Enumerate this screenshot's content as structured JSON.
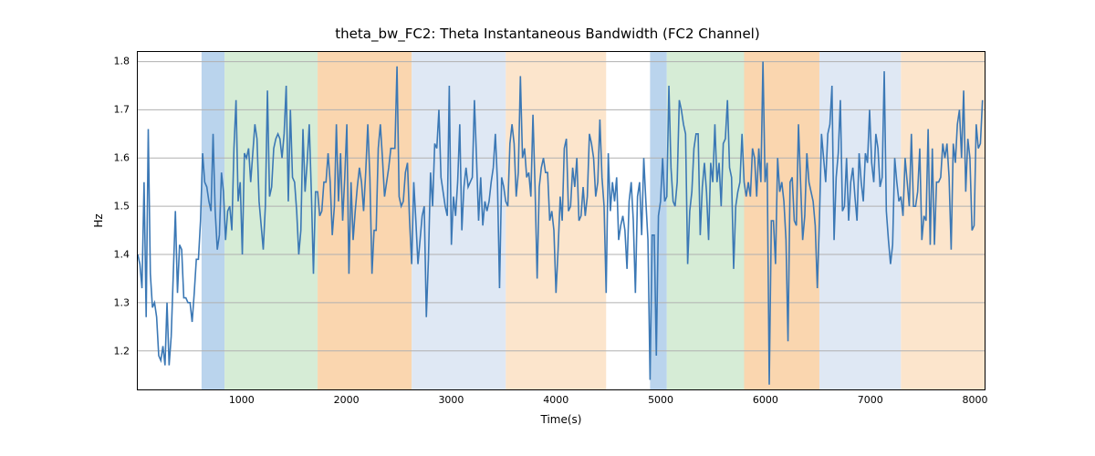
{
  "chart_data": {
    "type": "line",
    "title": "theta_bw_FC2: Theta Instantaneous Bandwidth (FC2 Channel)",
    "xlabel": "Time(s)",
    "ylabel": "Hz",
    "xlim": [
      0,
      8100
    ],
    "ylim": [
      1.12,
      1.82
    ],
    "xticks": [
      1000,
      2000,
      3000,
      4000,
      5000,
      6000,
      7000,
      8000
    ],
    "yticks": [
      1.2,
      1.3,
      1.4,
      1.5,
      1.6,
      1.7,
      1.8
    ],
    "bands": [
      {
        "x0": 610,
        "x1": 830,
        "class": "band-blue1"
      },
      {
        "x0": 830,
        "x1": 1720,
        "class": "band-green"
      },
      {
        "x0": 1720,
        "x1": 2620,
        "class": "band-orange1"
      },
      {
        "x0": 2620,
        "x1": 3520,
        "class": "band-blue2"
      },
      {
        "x0": 3520,
        "x1": 4480,
        "class": "band-orange2"
      },
      {
        "x0": 4900,
        "x1": 5060,
        "class": "band-blue1"
      },
      {
        "x0": 5060,
        "x1": 5800,
        "class": "band-green"
      },
      {
        "x0": 5800,
        "x1": 6520,
        "class": "band-orange1"
      },
      {
        "x0": 6520,
        "x1": 7300,
        "class": "band-blue2"
      },
      {
        "x0": 7300,
        "x1": 8100,
        "class": "band-orange2"
      }
    ],
    "series": [
      {
        "name": "theta_bw_FC2",
        "x_step": 20,
        "x_start": 0,
        "values": [
          1.4,
          1.38,
          1.33,
          1.55,
          1.27,
          1.66,
          1.36,
          1.29,
          1.3,
          1.27,
          1.19,
          1.18,
          1.21,
          1.17,
          1.3,
          1.17,
          1.23,
          1.36,
          1.49,
          1.32,
          1.42,
          1.41,
          1.31,
          1.31,
          1.3,
          1.3,
          1.26,
          1.32,
          1.39,
          1.39,
          1.47,
          1.61,
          1.55,
          1.54,
          1.51,
          1.49,
          1.65,
          1.49,
          1.41,
          1.44,
          1.57,
          1.53,
          1.43,
          1.49,
          1.5,
          1.45,
          1.62,
          1.72,
          1.51,
          1.55,
          1.4,
          1.61,
          1.6,
          1.62,
          1.55,
          1.61,
          1.67,
          1.64,
          1.51,
          1.46,
          1.41,
          1.5,
          1.74,
          1.52,
          1.54,
          1.62,
          1.64,
          1.65,
          1.64,
          1.6,
          1.65,
          1.75,
          1.51,
          1.7,
          1.56,
          1.55,
          1.49,
          1.4,
          1.45,
          1.66,
          1.53,
          1.59,
          1.67,
          1.53,
          1.36,
          1.53,
          1.53,
          1.48,
          1.49,
          1.55,
          1.55,
          1.61,
          1.55,
          1.44,
          1.5,
          1.67,
          1.51,
          1.61,
          1.47,
          1.56,
          1.67,
          1.36,
          1.55,
          1.43,
          1.49,
          1.54,
          1.58,
          1.55,
          1.49,
          1.57,
          1.67,
          1.56,
          1.36,
          1.45,
          1.45,
          1.62,
          1.67,
          1.6,
          1.52,
          1.55,
          1.58,
          1.62,
          1.62,
          1.62,
          1.79,
          1.52,
          1.5,
          1.51,
          1.57,
          1.59,
          1.47,
          1.38,
          1.55,
          1.47,
          1.38,
          1.43,
          1.48,
          1.5,
          1.27,
          1.39,
          1.57,
          1.5,
          1.63,
          1.62,
          1.7,
          1.56,
          1.53,
          1.5,
          1.48,
          1.75,
          1.42,
          1.52,
          1.48,
          1.55,
          1.67,
          1.45,
          1.54,
          1.58,
          1.54,
          1.55,
          1.56,
          1.72,
          1.6,
          1.47,
          1.56,
          1.46,
          1.51,
          1.49,
          1.51,
          1.55,
          1.58,
          1.65,
          1.55,
          1.33,
          1.56,
          1.54,
          1.51,
          1.5,
          1.63,
          1.67,
          1.63,
          1.52,
          1.57,
          1.77,
          1.6,
          1.62,
          1.56,
          1.57,
          1.52,
          1.69,
          1.54,
          1.35,
          1.54,
          1.58,
          1.6,
          1.57,
          1.57,
          1.47,
          1.49,
          1.45,
          1.32,
          1.41,
          1.52,
          1.47,
          1.62,
          1.64,
          1.49,
          1.5,
          1.58,
          1.54,
          1.6,
          1.47,
          1.48,
          1.54,
          1.48,
          1.52,
          1.65,
          1.63,
          1.6,
          1.52,
          1.55,
          1.68,
          1.56,
          1.5,
          1.32,
          1.61,
          1.49,
          1.55,
          1.51,
          1.56,
          1.43,
          1.46,
          1.48,
          1.45,
          1.37,
          1.51,
          1.55,
          1.47,
          1.32,
          1.52,
          1.55,
          1.44,
          1.6,
          1.51,
          1.43,
          1.14,
          1.44,
          1.44,
          1.19,
          1.48,
          1.51,
          1.6,
          1.51,
          1.52,
          1.75,
          1.58,
          1.51,
          1.5,
          1.55,
          1.72,
          1.7,
          1.67,
          1.65,
          1.38,
          1.49,
          1.53,
          1.62,
          1.65,
          1.65,
          1.44,
          1.54,
          1.59,
          1.53,
          1.43,
          1.59,
          1.55,
          1.67,
          1.55,
          1.59,
          1.5,
          1.63,
          1.64,
          1.72,
          1.58,
          1.56,
          1.37,
          1.5,
          1.53,
          1.55,
          1.65,
          1.55,
          1.52,
          1.55,
          1.52,
          1.62,
          1.6,
          1.52,
          1.62,
          1.55,
          1.8,
          1.55,
          1.59,
          1.13,
          1.47,
          1.47,
          1.38,
          1.6,
          1.53,
          1.55,
          1.51,
          1.43,
          1.22,
          1.55,
          1.56,
          1.47,
          1.46,
          1.67,
          1.55,
          1.43,
          1.48,
          1.61,
          1.55,
          1.53,
          1.51,
          1.46,
          1.33,
          1.47,
          1.65,
          1.6,
          1.55,
          1.65,
          1.67,
          1.75,
          1.43,
          1.56,
          1.61,
          1.72,
          1.49,
          1.5,
          1.6,
          1.47,
          1.55,
          1.58,
          1.52,
          1.47,
          1.61,
          1.55,
          1.51,
          1.61,
          1.59,
          1.7,
          1.59,
          1.55,
          1.65,
          1.62,
          1.54,
          1.56,
          1.78,
          1.49,
          1.43,
          1.38,
          1.42,
          1.6,
          1.55,
          1.51,
          1.52,
          1.48,
          1.6,
          1.55,
          1.5,
          1.65,
          1.5,
          1.5,
          1.53,
          1.62,
          1.43,
          1.48,
          1.47,
          1.66,
          1.42,
          1.62,
          1.42,
          1.55,
          1.55,
          1.56,
          1.63,
          1.6,
          1.63,
          1.56,
          1.41,
          1.63,
          1.59,
          1.67,
          1.7,
          1.6,
          1.74,
          1.53,
          1.64,
          1.6,
          1.45,
          1.46,
          1.67,
          1.62,
          1.63,
          1.72
        ]
      }
    ]
  }
}
